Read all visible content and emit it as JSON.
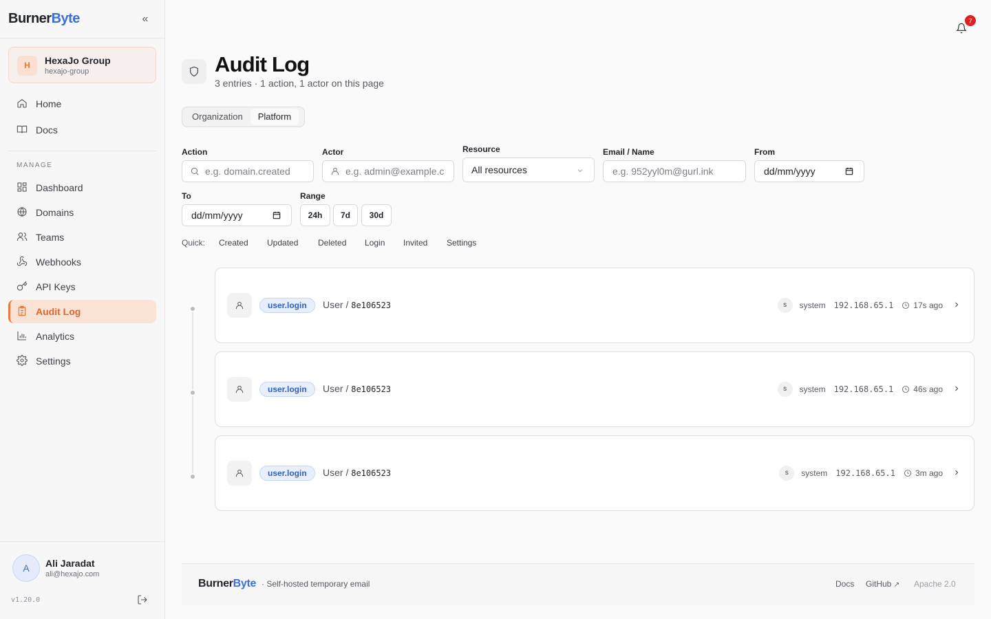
{
  "app": {
    "brand_part1": "Burner",
    "brand_part2": "Byte",
    "version": "v1.20.0"
  },
  "org": {
    "initial": "H",
    "name": "HexaJo Group",
    "slug": "hexajo-group"
  },
  "nav": {
    "top": [
      {
        "label": "Home",
        "icon": "home-icon"
      },
      {
        "label": "Docs",
        "icon": "book-icon"
      }
    ],
    "section_label": "MANAGE",
    "manage": [
      {
        "label": "Dashboard",
        "icon": "dashboard-icon"
      },
      {
        "label": "Domains",
        "icon": "globe-icon"
      },
      {
        "label": "Teams",
        "icon": "users-icon"
      },
      {
        "label": "Webhooks",
        "icon": "webhook-icon"
      },
      {
        "label": "API Keys",
        "icon": "key-icon"
      },
      {
        "label": "Audit Log",
        "icon": "clipboard-icon",
        "active": true
      },
      {
        "label": "Analytics",
        "icon": "bar-chart-icon"
      },
      {
        "label": "Settings",
        "icon": "gear-icon"
      }
    ]
  },
  "user": {
    "initial": "A",
    "name": "Ali Jaradat",
    "email": "ali@hexajo.com"
  },
  "notifications": {
    "count": "7"
  },
  "page": {
    "title": "Audit Log",
    "subtitle": "3 entries · 1 action, 1 actor on this page",
    "tabs": [
      "Organization",
      "Platform"
    ],
    "selected_tab": "Platform"
  },
  "filters": {
    "action": {
      "label": "Action",
      "placeholder": "e.g. domain.created"
    },
    "actor": {
      "label": "Actor",
      "placeholder": "e.g. admin@example.c"
    },
    "resource": {
      "label": "Resource",
      "value": "All resources"
    },
    "email": {
      "label": "Email / Name",
      "placeholder": "e.g. 952yyl0m@gurl.ink"
    },
    "from": {
      "label": "From",
      "value": "dd/mm/yyyy"
    },
    "to": {
      "label": "To",
      "value": "dd/mm/yyyy"
    },
    "range": {
      "label": "Range",
      "options": [
        "24h",
        "7d",
        "30d"
      ]
    },
    "quick": {
      "label": "Quick:",
      "options": [
        "Created",
        "Updated",
        "Deleted",
        "Login",
        "Invited",
        "Settings"
      ]
    }
  },
  "entries": [
    {
      "action": "user.login",
      "resource_type": "User /",
      "resource_id": "8e106523",
      "actor_initial": "s",
      "actor": "system",
      "ip": "192.168.65.1",
      "time": "17s ago"
    },
    {
      "action": "user.login",
      "resource_type": "User /",
      "resource_id": "8e106523",
      "actor_initial": "s",
      "actor": "system",
      "ip": "192.168.65.1",
      "time": "46s ago"
    },
    {
      "action": "user.login",
      "resource_type": "User /",
      "resource_id": "8e106523",
      "actor_initial": "s",
      "actor": "system",
      "ip": "192.168.65.1",
      "time": "3m ago"
    }
  ],
  "footer": {
    "brand_part1": "Burner",
    "brand_part2": "Byte",
    "tagline": "· Self-hosted temporary email",
    "docs": "Docs",
    "github": "GitHub",
    "license": "Apache 2.0"
  },
  "colors": {
    "accent": "#e97a3e",
    "brand_blue": "#3b6fd8",
    "badge_red": "#e02020"
  }
}
